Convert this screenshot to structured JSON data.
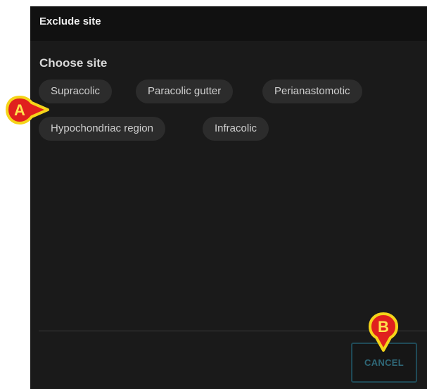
{
  "dialog": {
    "title": "Exclude site",
    "section_label": "Choose site",
    "sites": [
      {
        "label": "Supracolic"
      },
      {
        "label": "Paracolic gutter"
      },
      {
        "label": "Perianastomotic"
      },
      {
        "label": "Hypochondriac region"
      },
      {
        "label": "Infracolic"
      }
    ],
    "cancel_label": "CANCEL"
  },
  "callouts": {
    "a": "A",
    "b": "B"
  },
  "colors": {
    "dialog_background": "#1a1a1a",
    "header_background": "#111111",
    "chip_background": "#2c2c2c",
    "cancel_accent": "#2f6878",
    "callout_fill": "#e0201e",
    "callout_border": "#f5d419",
    "callout_text": "#ffe34d"
  }
}
